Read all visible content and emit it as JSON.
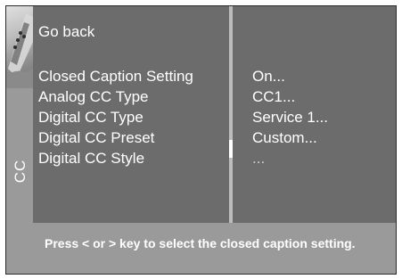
{
  "menu": {
    "side_label": "CC",
    "go_back": "Go back",
    "items": [
      {
        "label": "Closed Caption Setting",
        "value": "On..."
      },
      {
        "label": "Analog CC Type",
        "value": "CC1..."
      },
      {
        "label": "Digital CC Type",
        "value": "Service 1..."
      },
      {
        "label": "Digital CC Preset",
        "value": "Custom..."
      },
      {
        "label": "Digital CC Style",
        "value": "..."
      }
    ]
  },
  "help": {
    "text": "Press < or > key to select the closed caption setting."
  },
  "icons": {
    "side_image": "remote-control-icon"
  },
  "colors": {
    "panel": "#6c6c6c",
    "side_panel": "#9a9a9a",
    "text": "#ffffff"
  }
}
